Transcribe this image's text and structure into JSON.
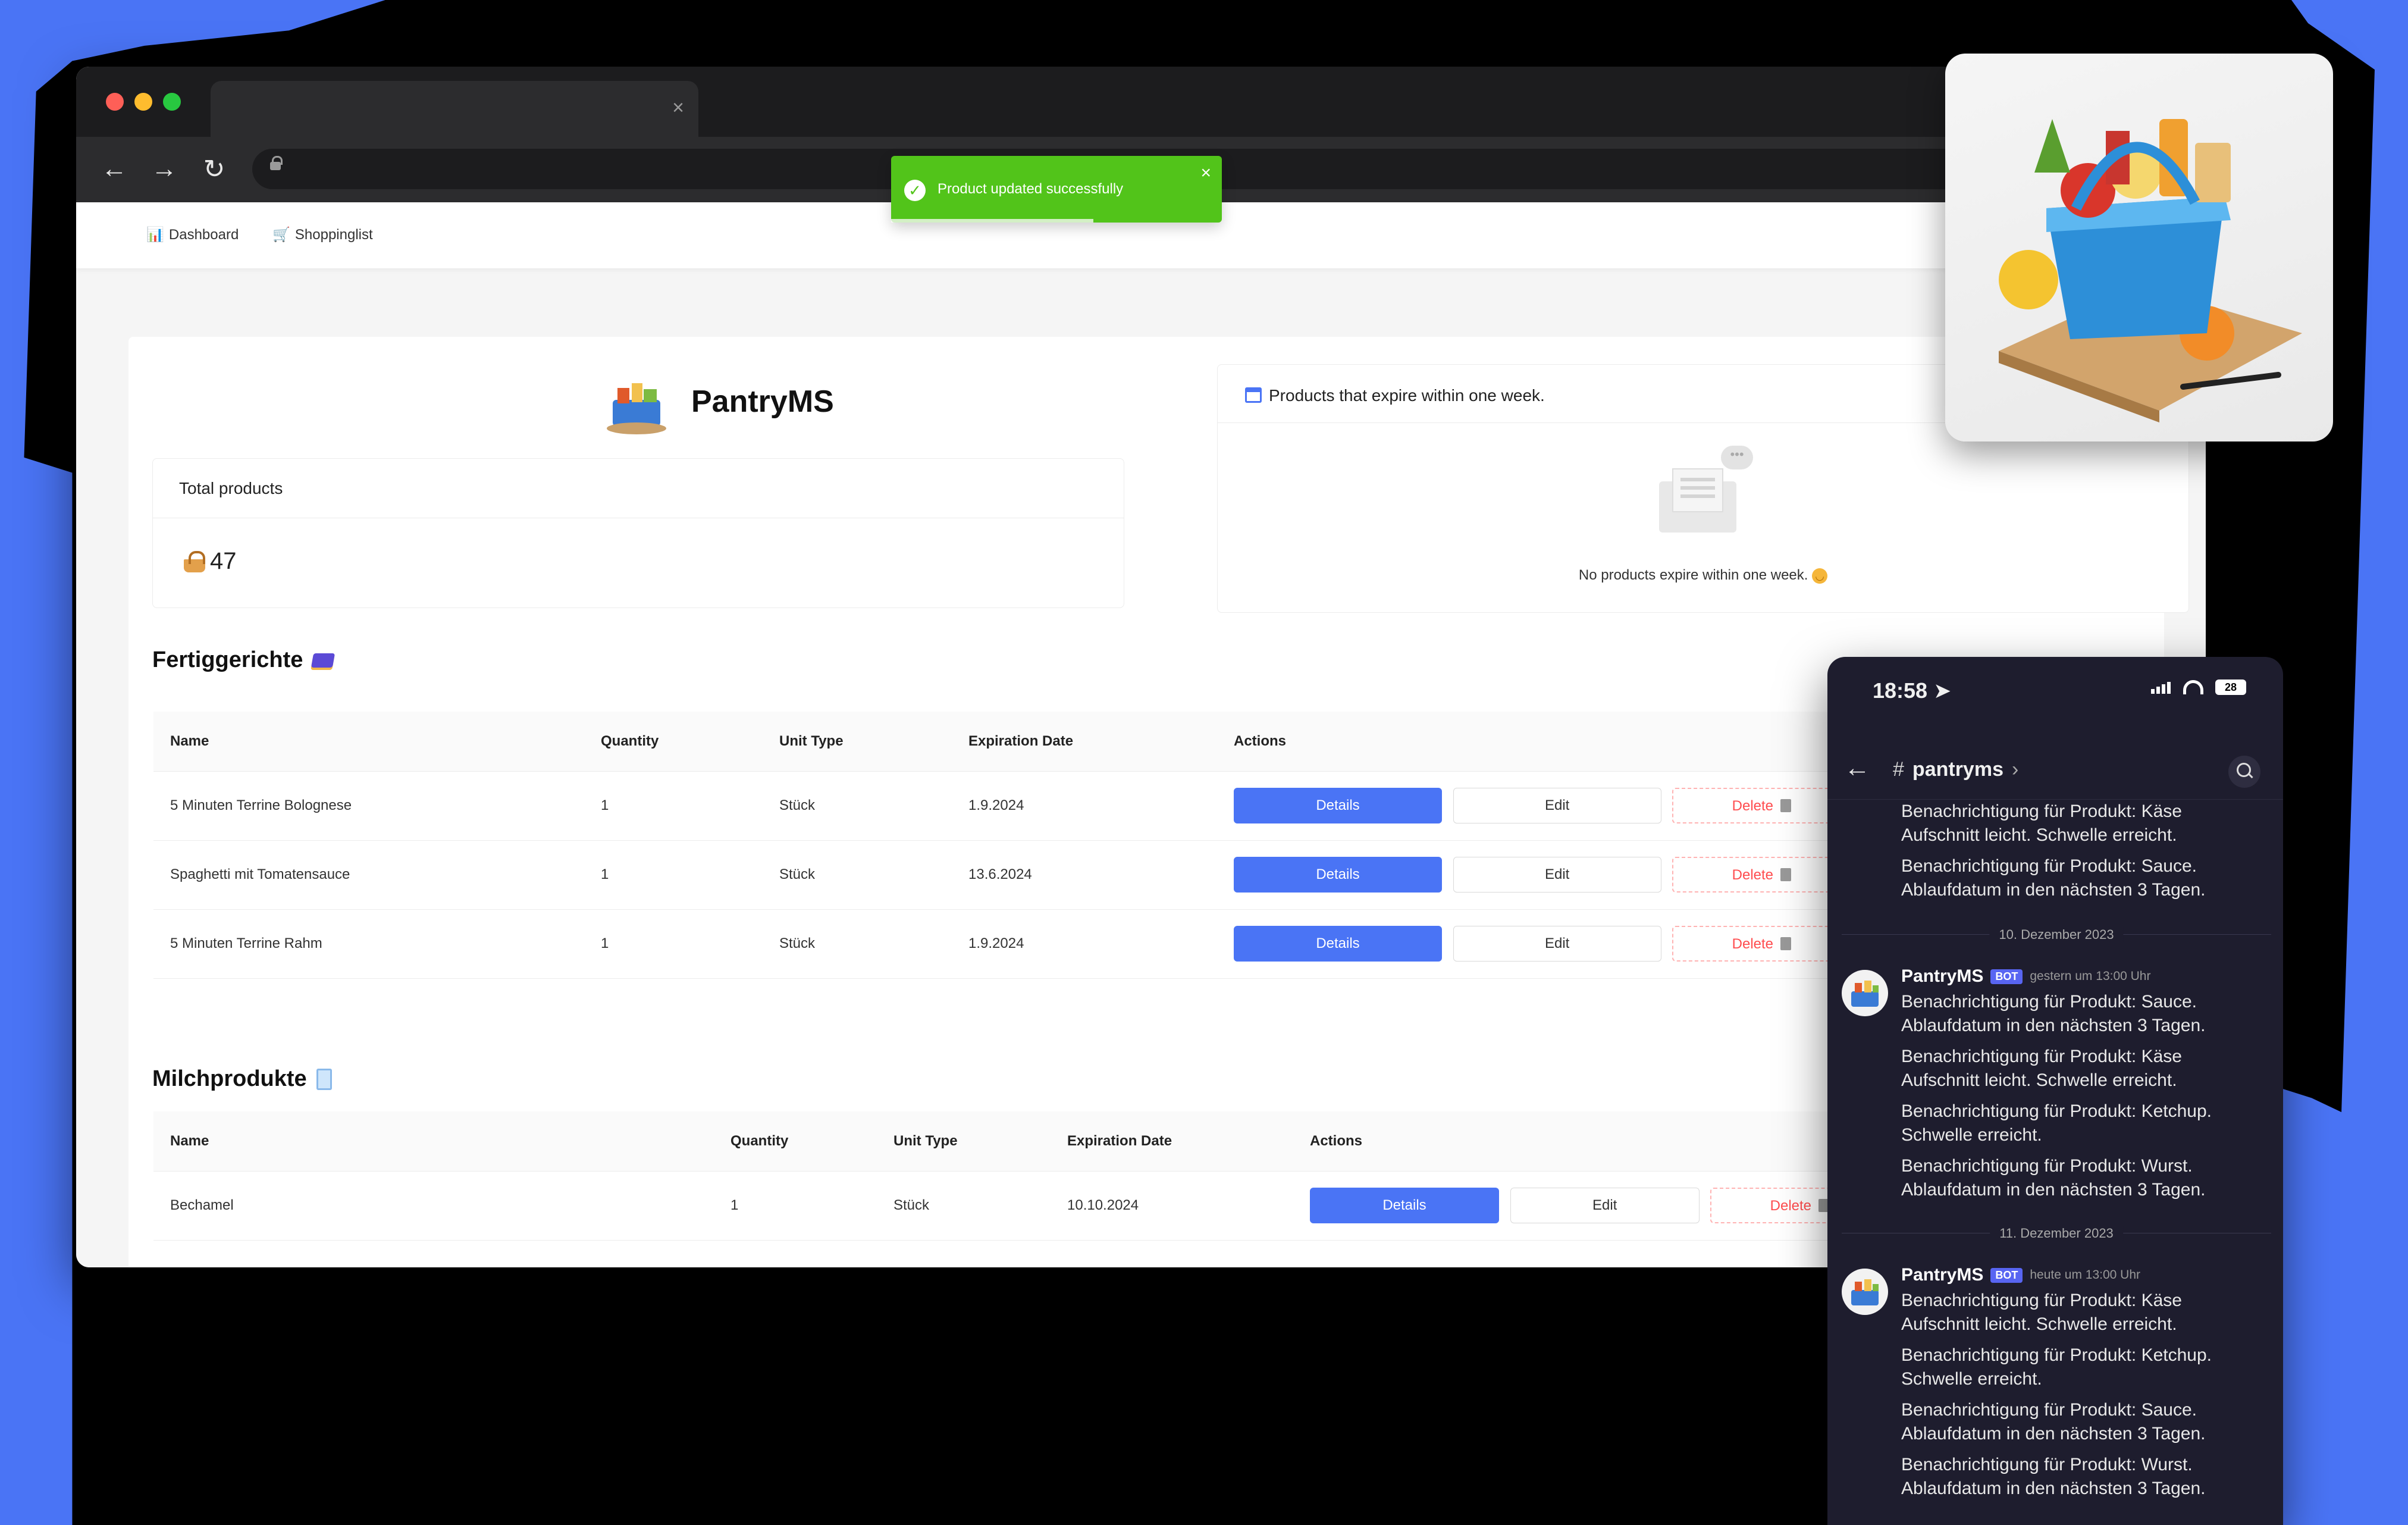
{
  "browser": {
    "tab_close": "×",
    "nav": {
      "dashboard": "Dashboard",
      "shoppinglist": "Shoppinglist"
    }
  },
  "toast": {
    "message": "Product updated successfully",
    "close": "×"
  },
  "brand": {
    "name": "PantryMS"
  },
  "total_products": {
    "title": "Total products",
    "value": "47"
  },
  "expire": {
    "title": "Products that expire within one week.",
    "empty_text": "No products expire within one week."
  },
  "sections": [
    {
      "title": "Fertiggerichte",
      "columns": [
        "Name",
        "Quantity",
        "Unit Type",
        "Expiration Date",
        "Actions"
      ],
      "rows": [
        {
          "name": "5 Minuten Terrine Bolognese",
          "quantity": "1",
          "unit": "Stück",
          "date": "1.9.2024"
        },
        {
          "name": "Spaghetti mit Tomatensauce",
          "quantity": "1",
          "unit": "Stück",
          "date": "13.6.2024"
        },
        {
          "name": "5 Minuten Terrine Rahm",
          "quantity": "1",
          "unit": "Stück",
          "date": "1.9.2024"
        }
      ]
    },
    {
      "title": "Milchprodukte",
      "columns": [
        "Name",
        "Quantity",
        "Unit Type",
        "Expiration Date",
        "Actions"
      ],
      "rows": [
        {
          "name": "Bechamel",
          "quantity": "1",
          "unit": "Stück",
          "date": "10.10.2024"
        }
      ]
    }
  ],
  "actions": {
    "details": "Details",
    "edit": "Edit",
    "delete": "Delete"
  },
  "phone": {
    "time": "18:58",
    "battery": "28",
    "channel": "pantryms",
    "top_messages": [
      "Benachrichtigung für Produkt: Käse Aufschnitt leicht. Schwelle erreicht.",
      "Benachrichtigung für Produkt: Sauce. Ablaufdatum in den nächsten 3 Tagen."
    ],
    "groups": [
      {
        "date": "10. Dezember 2023",
        "author": "PantryMS",
        "badge": "BOT",
        "timestamp": "gestern um 13:00 Uhr",
        "messages": [
          "Benachrichtigung für Produkt: Sauce. Ablaufdatum in den nächsten 3 Tagen.",
          "Benachrichtigung für Produkt: Käse Aufschnitt leicht. Schwelle erreicht.",
          "Benachrichtigung für Produkt: Ketchup. Schwelle erreicht.",
          "Benachrichtigung für Produkt: Wurst. Ablaufdatum in den nächsten 3 Tagen."
        ]
      },
      {
        "date": "11. Dezember 2023",
        "author": "PantryMS",
        "badge": "BOT",
        "timestamp": "heute um 13:00 Uhr",
        "messages": [
          "Benachrichtigung für Produkt: Käse Aufschnitt leicht. Schwelle erreicht.",
          "Benachrichtigung für Produkt: Ketchup. Schwelle erreicht.",
          "Benachrichtigung für Produkt: Sauce. Ablaufdatum in den nächsten 3 Tagen.",
          "Benachrichtigung für Produkt: Wurst. Ablaufdatum in den nächsten 3 Tagen."
        ]
      }
    ]
  },
  "colors": {
    "accent": "#4a74f5",
    "success": "#52c41a",
    "danger": "#ff4d4f",
    "background": "#4a74f5"
  }
}
